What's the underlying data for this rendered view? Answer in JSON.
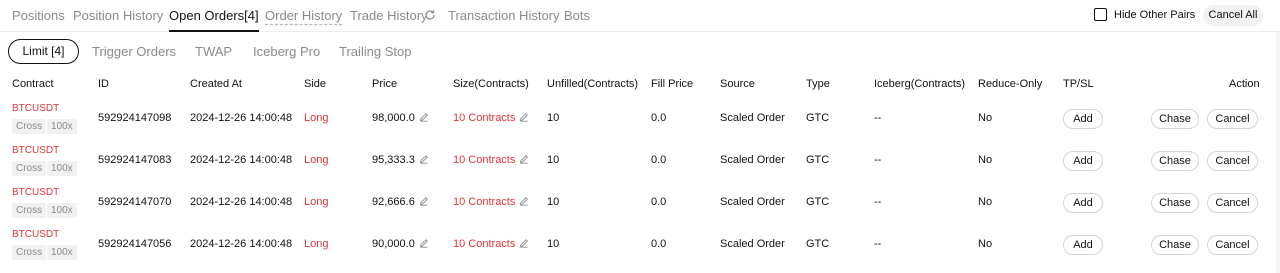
{
  "top_tabs": [
    {
      "label": "Positions"
    },
    {
      "label": "Position History"
    },
    {
      "label": "Open Orders[4]"
    },
    {
      "label": "Order History"
    },
    {
      "label": "Trade History"
    },
    {
      "label": "Transaction History"
    },
    {
      "label": "Bots"
    }
  ],
  "hide_other_pairs": "Hide Other Pairs",
  "cancel_all": "Cancel All",
  "sub_tabs": [
    {
      "label": "Limit [4]"
    },
    {
      "label": "Trigger Orders"
    },
    {
      "label": "TWAP"
    },
    {
      "label": "Iceberg Pro"
    },
    {
      "label": "Trailing Stop"
    }
  ],
  "columns": [
    "Contract",
    "ID",
    "Created At",
    "Side",
    "Price",
    "Size(Contracts)",
    "Unfilled(Contracts)",
    "Fill Price",
    "Source",
    "Type",
    "Iceberg(Contracts)",
    "Reduce-Only",
    "TP/SL",
    "Action"
  ],
  "rows": [
    {
      "symbol": "BTCUSDT",
      "margin": "Cross",
      "leverage": "100x",
      "id": "592924147098",
      "created": "2024-12-26 14:00:48",
      "side": "Long",
      "price": "98,000.0",
      "size": "10 Contracts",
      "unfilled": "10",
      "fill_price": "0.0",
      "source": "Scaled Order",
      "type": "GTC",
      "iceberg": "--",
      "reduce_only": "No",
      "tpsl": "Add",
      "chase": "Chase",
      "cancel": "Cancel"
    },
    {
      "symbol": "BTCUSDT",
      "margin": "Cross",
      "leverage": "100x",
      "id": "592924147083",
      "created": "2024-12-26 14:00:48",
      "side": "Long",
      "price": "95,333.3",
      "size": "10 Contracts",
      "unfilled": "10",
      "fill_price": "0.0",
      "source": "Scaled Order",
      "type": "GTC",
      "iceberg": "--",
      "reduce_only": "No",
      "tpsl": "Add",
      "chase": "Chase",
      "cancel": "Cancel"
    },
    {
      "symbol": "BTCUSDT",
      "margin": "Cross",
      "leverage": "100x",
      "id": "592924147070",
      "created": "2024-12-26 14:00:48",
      "side": "Long",
      "price": "92,666.6",
      "size": "10 Contracts",
      "unfilled": "10",
      "fill_price": "0.0",
      "source": "Scaled Order",
      "type": "GTC",
      "iceberg": "--",
      "reduce_only": "No",
      "tpsl": "Add",
      "chase": "Chase",
      "cancel": "Cancel"
    },
    {
      "symbol": "BTCUSDT",
      "margin": "Cross",
      "leverage": "100x",
      "id": "592924147056",
      "created": "2024-12-26 14:00:48",
      "side": "Long",
      "price": "90,000.0",
      "size": "10 Contracts",
      "unfilled": "10",
      "fill_price": "0.0",
      "source": "Scaled Order",
      "type": "GTC",
      "iceberg": "--",
      "reduce_only": "No",
      "tpsl": "Add",
      "chase": "Chase",
      "cancel": "Cancel"
    }
  ],
  "colors": {
    "accent_red": "#e0353b",
    "text": "#121212",
    "muted": "#8a8a8a",
    "tag_bg": "#f1f1f1"
  },
  "icons": {
    "refresh": "refresh-icon",
    "edit": "edit-icon"
  }
}
